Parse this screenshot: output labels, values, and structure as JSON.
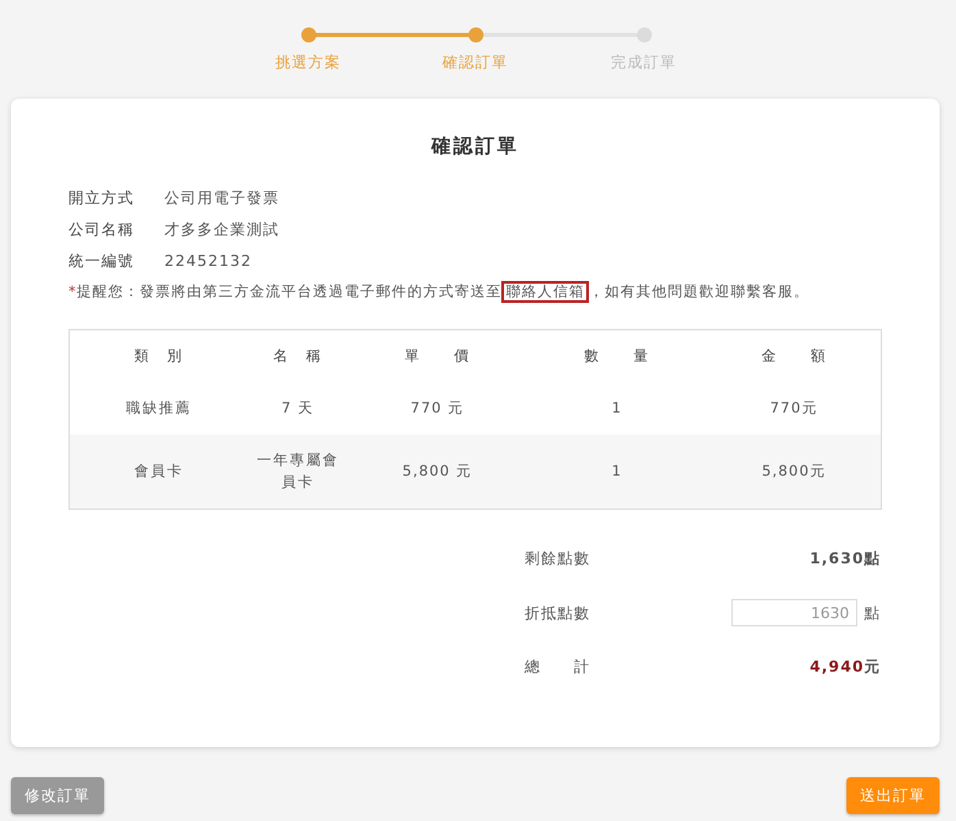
{
  "steps": [
    {
      "label": "挑選方案",
      "reached": true
    },
    {
      "label": "確認訂單",
      "reached": true
    },
    {
      "label": "完成訂單",
      "reached": false
    }
  ],
  "card": {
    "title": "確認訂單",
    "info": [
      {
        "label": "開立方式",
        "value": "公司用電子發票"
      },
      {
        "label": "公司名稱",
        "value": "才多多企業測試"
      },
      {
        "label": "統一編號",
        "value": "22452132"
      }
    ],
    "notice": {
      "marker": "*",
      "before": "提醒您：發票將由第三方金流平台透過電子郵件的方式寄送至",
      "highlight": "聯絡人信箱",
      "after": "，如有其他問題歡迎聯繫客服。"
    },
    "table": {
      "columns": [
        "類　別",
        "名　稱",
        "單　　價",
        "數　　量",
        "金　　額"
      ],
      "rows": [
        {
          "cells": [
            "職缺推薦",
            "7 天",
            "770 元",
            "1",
            "770元"
          ]
        },
        {
          "cells": [
            "會員卡",
            "一年專屬會員卡",
            "5,800 元",
            "1",
            "5,800元"
          ]
        }
      ]
    },
    "summary": {
      "remaining_label": "剩餘點數",
      "remaining_value": "1,630點",
      "deduct_label": "折抵點數",
      "deduct_value": "1630",
      "deduct_unit": "點",
      "total_label": "總　　計",
      "total_amount": "4,940",
      "total_unit": "元"
    }
  },
  "buttons": {
    "back": "修改訂單",
    "submit": "送出訂單"
  }
}
